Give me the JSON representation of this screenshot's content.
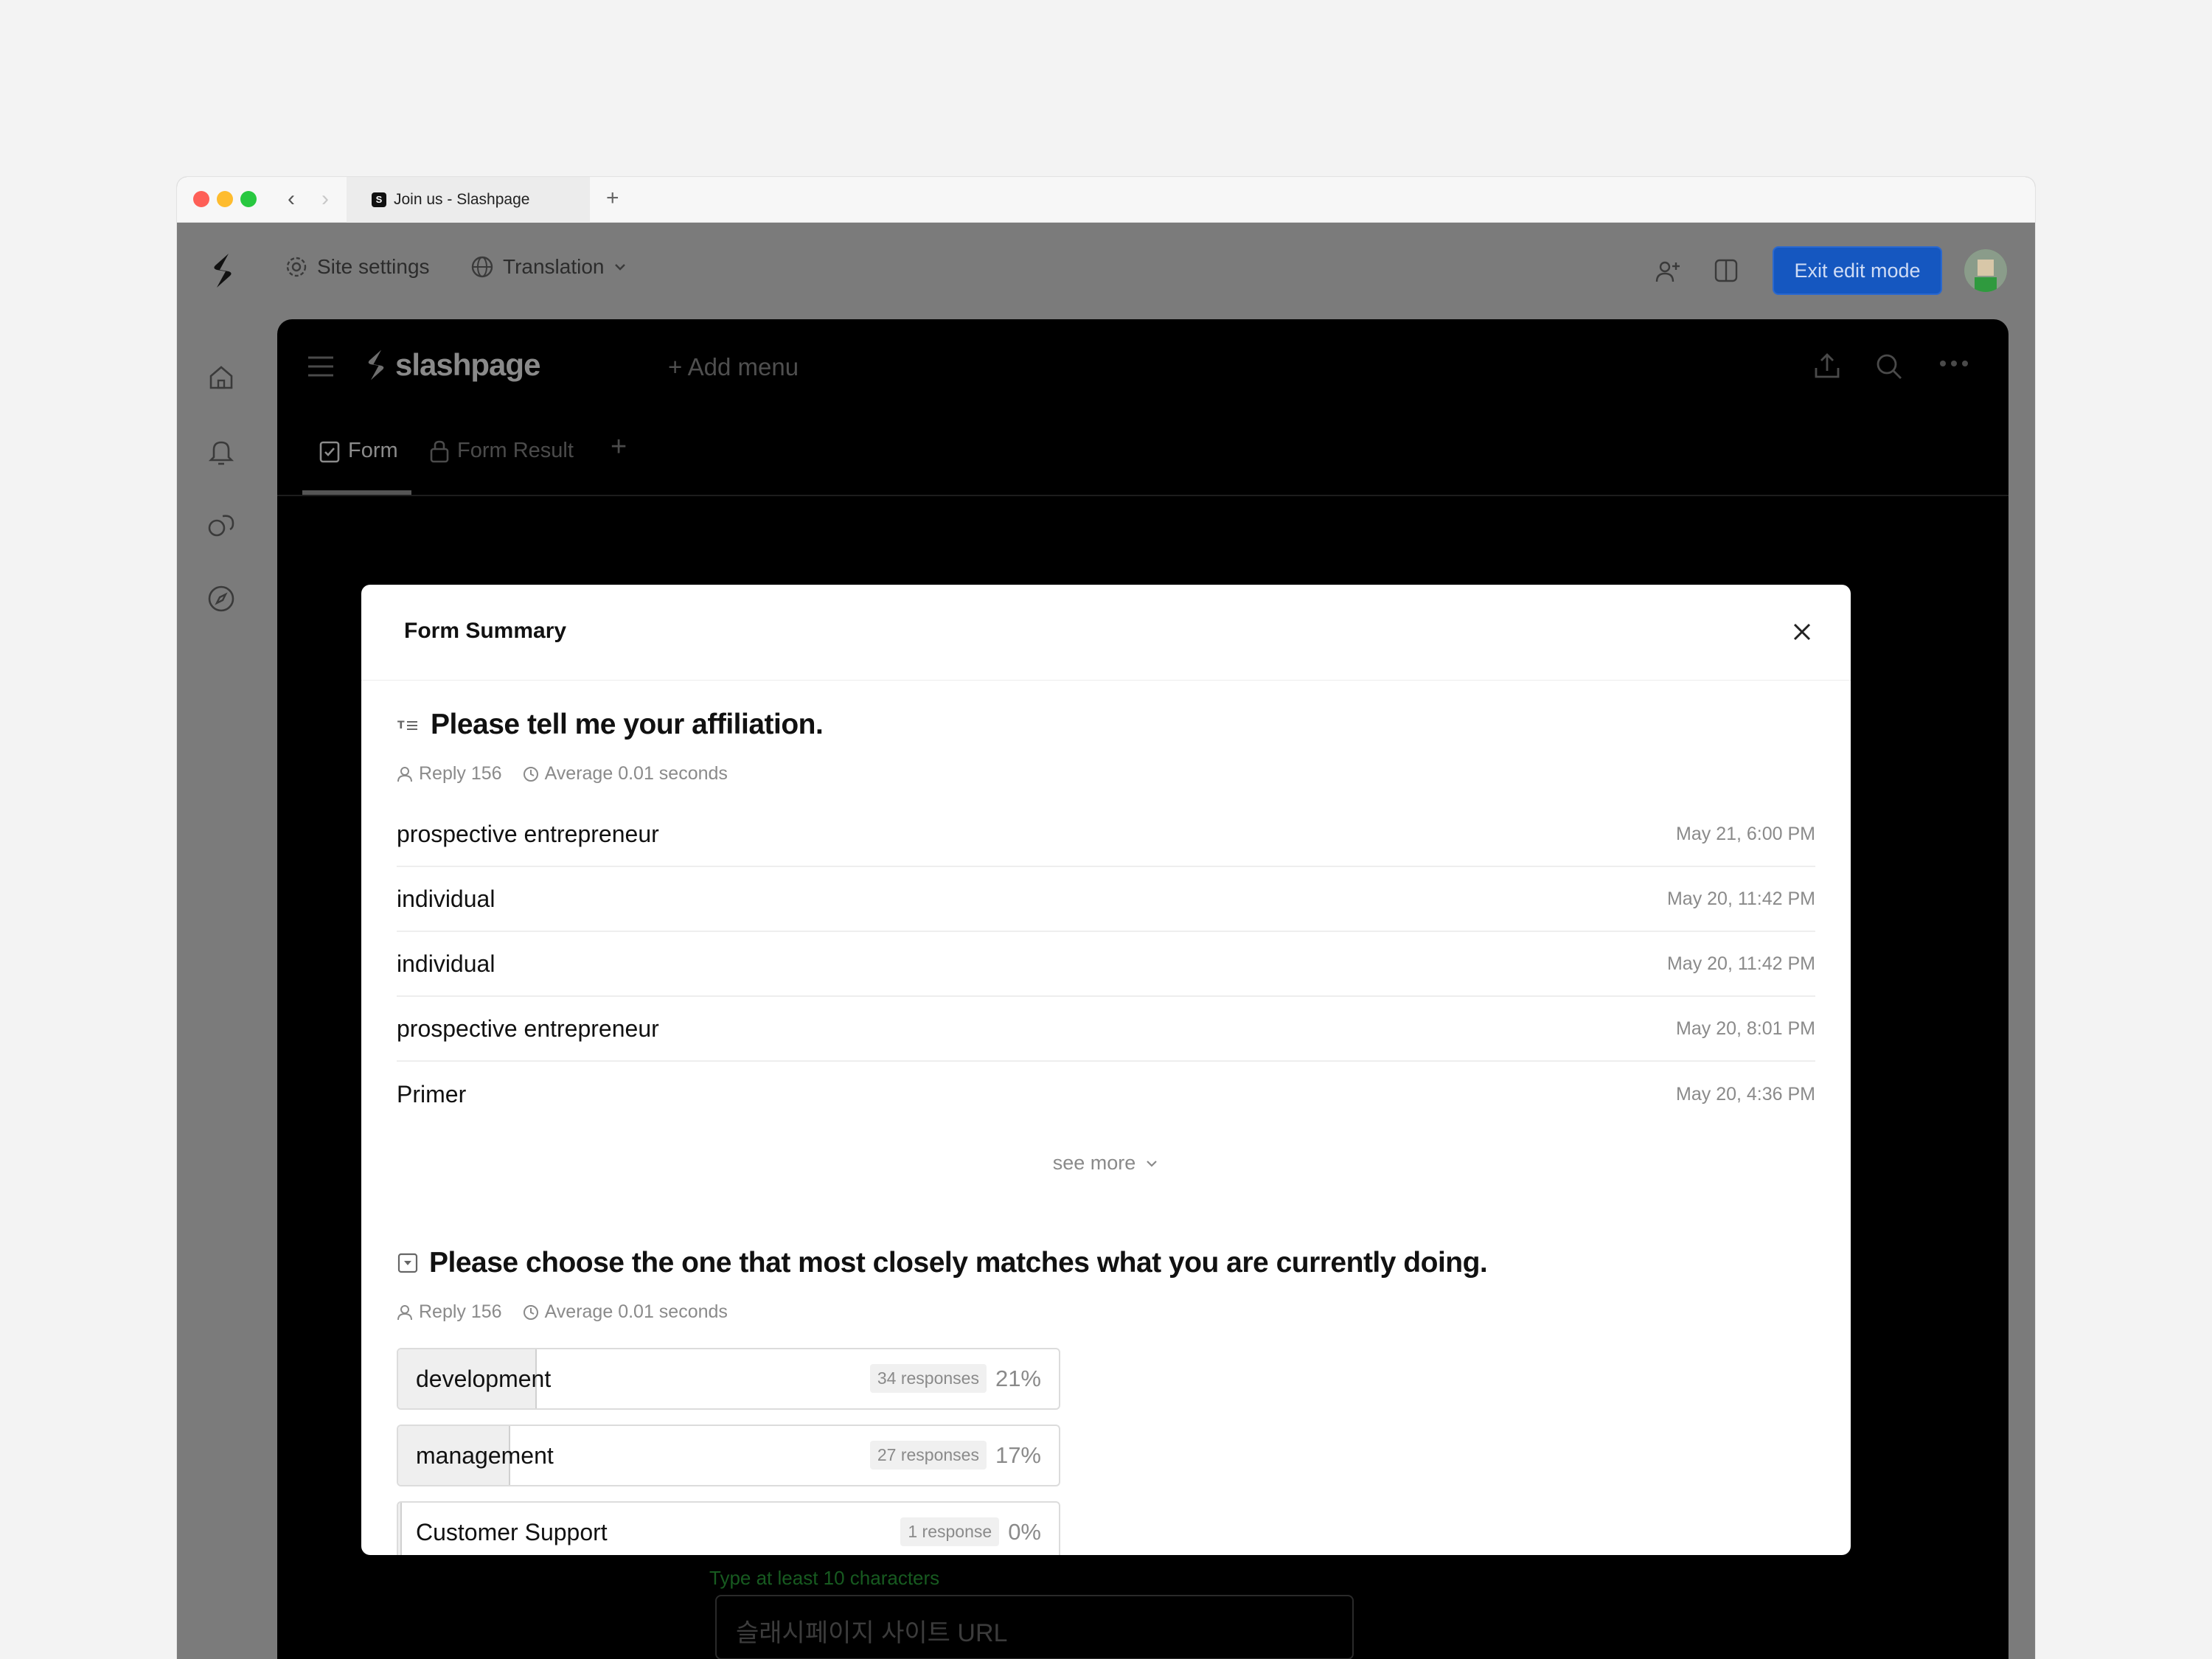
{
  "browser": {
    "tab_title": "Join us - Slashpage"
  },
  "topbar": {
    "site_settings": "Site settings",
    "translation": "Translation",
    "exit_edit_mode": "Exit edit mode"
  },
  "page": {
    "brand": "slashpage",
    "add_menu": "+ Add menu",
    "tabs": [
      {
        "label": "Form"
      },
      {
        "label": "Form Result"
      }
    ],
    "bg_hint": "Type at least 10 characters",
    "bg_input_placeholder": "슬래시페이지 사이트 URL"
  },
  "modal": {
    "title": "Form Summary",
    "q1": {
      "title": "Please tell me your affiliation.",
      "reply": "Reply 156",
      "average": "Average 0.01 seconds",
      "answers": [
        {
          "text": "prospective entrepreneur",
          "time": "May 21, 6:00 PM"
        },
        {
          "text": "individual",
          "time": "May 20, 11:42 PM"
        },
        {
          "text": "individual",
          "time": "May 20, 11:42 PM"
        },
        {
          "text": "prospective entrepreneur",
          "time": "May 20, 8:01 PM"
        },
        {
          "text": "Primer",
          "time": "May 20, 4:36 PM"
        }
      ],
      "see_more": "see more"
    },
    "q2": {
      "title": "Please choose the one that most closely matches what you are currently doing.",
      "reply": "Reply 156",
      "average": "Average 0.01 seconds",
      "choices": [
        {
          "label": "development",
          "responses": "34 responses",
          "pct": "21%",
          "share": 0.21
        },
        {
          "label": "management",
          "responses": "27 responses",
          "pct": "17%",
          "share": 0.17
        },
        {
          "label": "Customer Support",
          "responses": "1 response",
          "pct": "0%",
          "share": 0.006
        }
      ]
    }
  },
  "colors": {
    "accent": "#1557c0",
    "hint_green": "#175a20"
  }
}
